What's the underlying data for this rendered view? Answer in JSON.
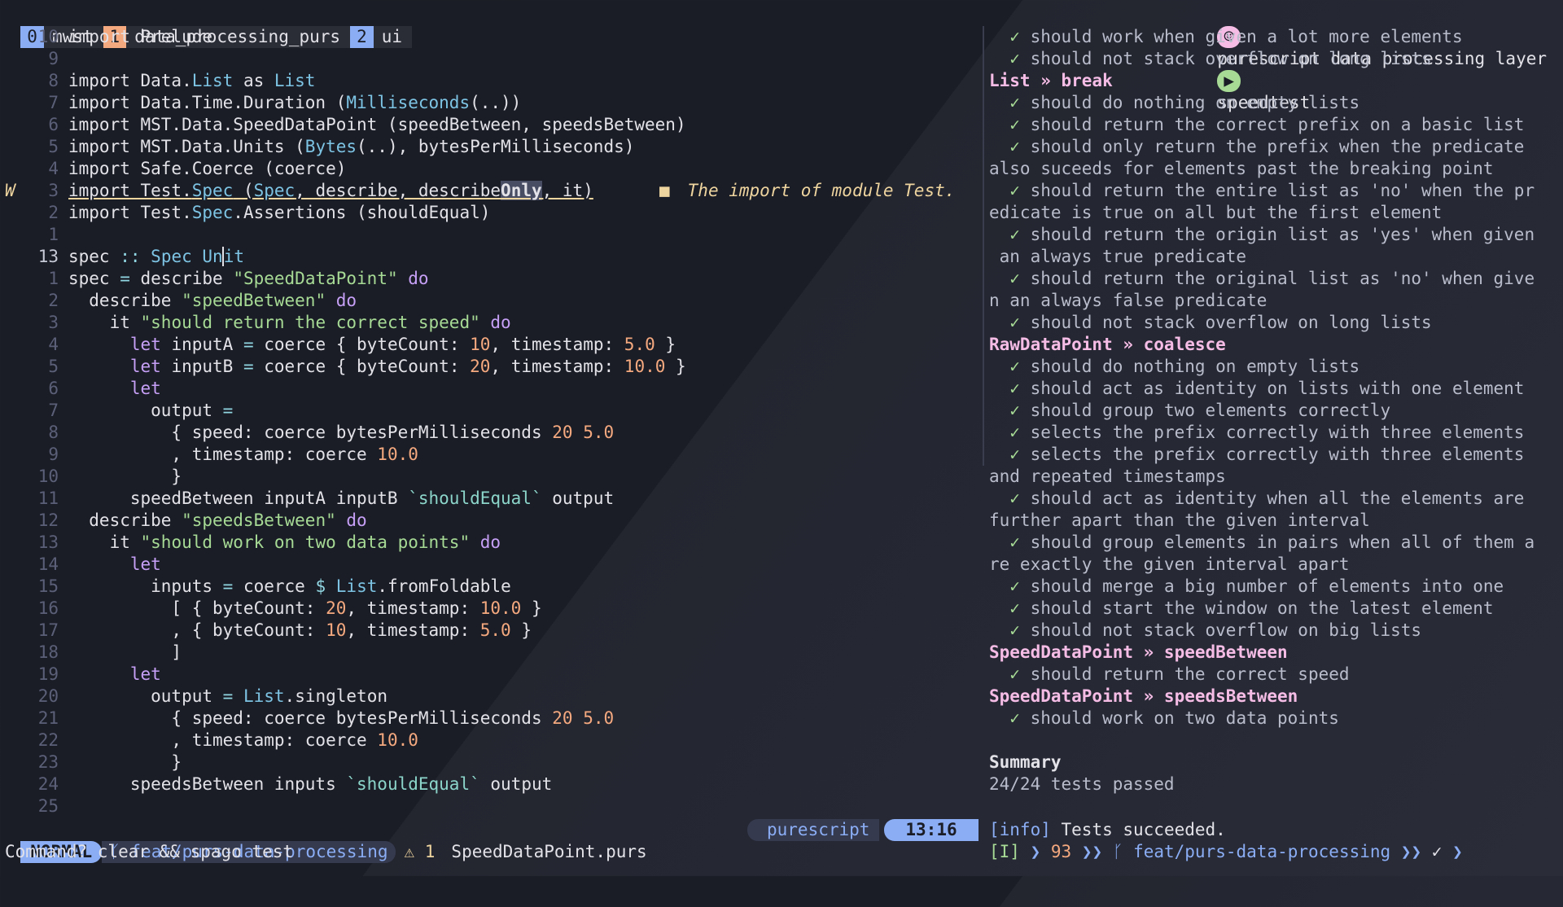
{
  "tabbar": {
    "tabs": [
      {
        "index": "0",
        "name": "mwst"
      },
      {
        "index": "1",
        "name": "data_processing_purs"
      },
      {
        "index": "2",
        "name": "ui"
      }
    ],
    "right_title": "purescript data processing layer",
    "right_icon": "person-icon",
    "terminal_icon": "terminal-icon",
    "right_session": "speedtest"
  },
  "editor": {
    "lines": [
      {
        "num": "10",
        "text": "import Prelude"
      },
      {
        "num": "9",
        "text": ""
      },
      {
        "num": "8",
        "text": "import Data.List as List"
      },
      {
        "num": "7",
        "text": "import Data.Time.Duration (Milliseconds(..))"
      },
      {
        "num": "6",
        "text": "import MST.Data.SpeedDataPoint (speedBetween, speedsBetween)"
      },
      {
        "num": "5",
        "text": "import MST.Data.Units (Bytes(..), bytesPerMilliseconds)"
      },
      {
        "num": "4",
        "text": "import Safe.Coerce (coerce)"
      },
      {
        "num": "3",
        "text": "import Test.Spec (Spec, describe, describeOnly, it)"
      },
      {
        "num": "2",
        "text": "import Test.Spec.Assertions (shouldEqual)"
      },
      {
        "num": "1",
        "text": ""
      },
      {
        "num": "13",
        "text": "spec :: Spec Unit"
      },
      {
        "num": "1",
        "text": "spec = describe \"SpeedDataPoint\" do"
      },
      {
        "num": "2",
        "text": "  describe \"speedBetween\" do"
      },
      {
        "num": "3",
        "text": "    it \"should return the correct speed\" do"
      },
      {
        "num": "4",
        "text": "      let inputA = coerce { byteCount: 10, timestamp: 5.0 }"
      },
      {
        "num": "5",
        "text": "      let inputB = coerce { byteCount: 20, timestamp: 10.0 }"
      },
      {
        "num": "6",
        "text": "      let"
      },
      {
        "num": "7",
        "text": "        output ="
      },
      {
        "num": "8",
        "text": "          { speed: coerce bytesPerMilliseconds 20 5.0"
      },
      {
        "num": "9",
        "text": "          , timestamp: coerce 10.0"
      },
      {
        "num": "10",
        "text": "          }"
      },
      {
        "num": "11",
        "text": "      speedBetween inputA inputB `shouldEqual` output"
      },
      {
        "num": "12",
        "text": "  describe \"speedsBetween\" do"
      },
      {
        "num": "13",
        "text": "    it \"should work on two data points\" do"
      },
      {
        "num": "14",
        "text": "      let"
      },
      {
        "num": "15",
        "text": "        inputs = coerce $ List.fromFoldable"
      },
      {
        "num": "16",
        "text": "          [ { byteCount: 20, timestamp: 10.0 }"
      },
      {
        "num": "17",
        "text": "          , { byteCount: 10, timestamp: 5.0 }"
      },
      {
        "num": "18",
        "text": "          ]"
      },
      {
        "num": "19",
        "text": "      let"
      },
      {
        "num": "20",
        "text": "        output = List.singleton"
      },
      {
        "num": "21",
        "text": "          { speed: coerce bytesPerMilliseconds 20 5.0"
      },
      {
        "num": "22",
        "text": "          , timestamp: coerce 10.0"
      },
      {
        "num": "23",
        "text": "          }"
      },
      {
        "num": "24",
        "text": "      speedsBetween inputs `shouldEqual` output"
      },
      {
        "num": "25",
        "text": ""
      }
    ],
    "sign": "W",
    "diagnostic": "The import of module Test."
  },
  "output": {
    "lines": [
      {
        "kind": "check",
        "text": "should work when given a lot more elements"
      },
      {
        "kind": "check",
        "text": "should not stack overflow on long lists"
      },
      {
        "kind": "head",
        "text": "List » break"
      },
      {
        "kind": "check",
        "text": "should do nothing on empty lists"
      },
      {
        "kind": "check",
        "text": "should return the correct prefix on a basic list"
      },
      {
        "kind": "check",
        "text": "should only return the prefix when the predicate"
      },
      {
        "kind": "wrap",
        "text": "also suceeds for elements past the breaking point"
      },
      {
        "kind": "check",
        "text": "should return the entire list as 'no' when the pr"
      },
      {
        "kind": "wrap",
        "text": "edicate is true on all but the first element"
      },
      {
        "kind": "check",
        "text": "should return the origin list as 'yes' when given"
      },
      {
        "kind": "wrap",
        "text": " an always true predicate"
      },
      {
        "kind": "check",
        "text": "should return the original list as 'no' when give"
      },
      {
        "kind": "wrap",
        "text": "n an always false predicate"
      },
      {
        "kind": "check",
        "text": "should not stack overflow on long lists"
      },
      {
        "kind": "head",
        "text": "RawDataPoint » coalesce"
      },
      {
        "kind": "check",
        "text": "should do nothing on empty lists"
      },
      {
        "kind": "check",
        "text": "should act as identity on lists with one element"
      },
      {
        "kind": "check",
        "text": "should group two elements correctly"
      },
      {
        "kind": "check",
        "text": "selects the prefix correctly with three elements"
      },
      {
        "kind": "check",
        "text": "selects the prefix correctly with three elements"
      },
      {
        "kind": "wrap",
        "text": "and repeated timestamps"
      },
      {
        "kind": "check",
        "text": "should act as identity when all the elements are"
      },
      {
        "kind": "wrap",
        "text": "further apart than the given interval"
      },
      {
        "kind": "check",
        "text": "should group elements in pairs when all of them a"
      },
      {
        "kind": "wrap",
        "text": "re exactly the given interval apart"
      },
      {
        "kind": "check",
        "text": "should merge a big number of elements into one"
      },
      {
        "kind": "check",
        "text": "should start the window on the latest element"
      },
      {
        "kind": "check",
        "text": "should not stack overflow on big lists"
      },
      {
        "kind": "head",
        "text": "SpeedDataPoint » speedBetween"
      },
      {
        "kind": "check",
        "text": "should return the correct speed"
      },
      {
        "kind": "head",
        "text": "SpeedDataPoint » speedsBetween"
      },
      {
        "kind": "check",
        "text": "should work on two data points"
      },
      {
        "kind": "blank",
        "text": ""
      },
      {
        "kind": "plain",
        "text": "Summary"
      },
      {
        "kind": "wrap",
        "text": "24/24 tests passed"
      }
    ],
    "check_glyph": "✓",
    "info_tag": "[info]",
    "info_text": "Tests succeeded.",
    "prompt": {
      "mode": "[I]",
      "arrow": "❯",
      "count": "93",
      "double": "❯❯",
      "branch": "feat/purs-data-processing",
      "check": "✓"
    }
  },
  "statusline": {
    "mode": "NORMAL",
    "branch": "feat/purs-data-processing",
    "warnings": "⚠ 1",
    "filename": "SpeedDataPoint.purs",
    "filetype": "purescript",
    "position": "13:16"
  },
  "cmdline": {
    "text": "Command? clear && spago test"
  },
  "colors": {
    "accent_blue": "#8aadf4",
    "accent_orange": "#f5a97f",
    "accent_pink": "#f5bde6",
    "accent_green": "#a6da95",
    "warning_yellow": "#eed49f"
  }
}
